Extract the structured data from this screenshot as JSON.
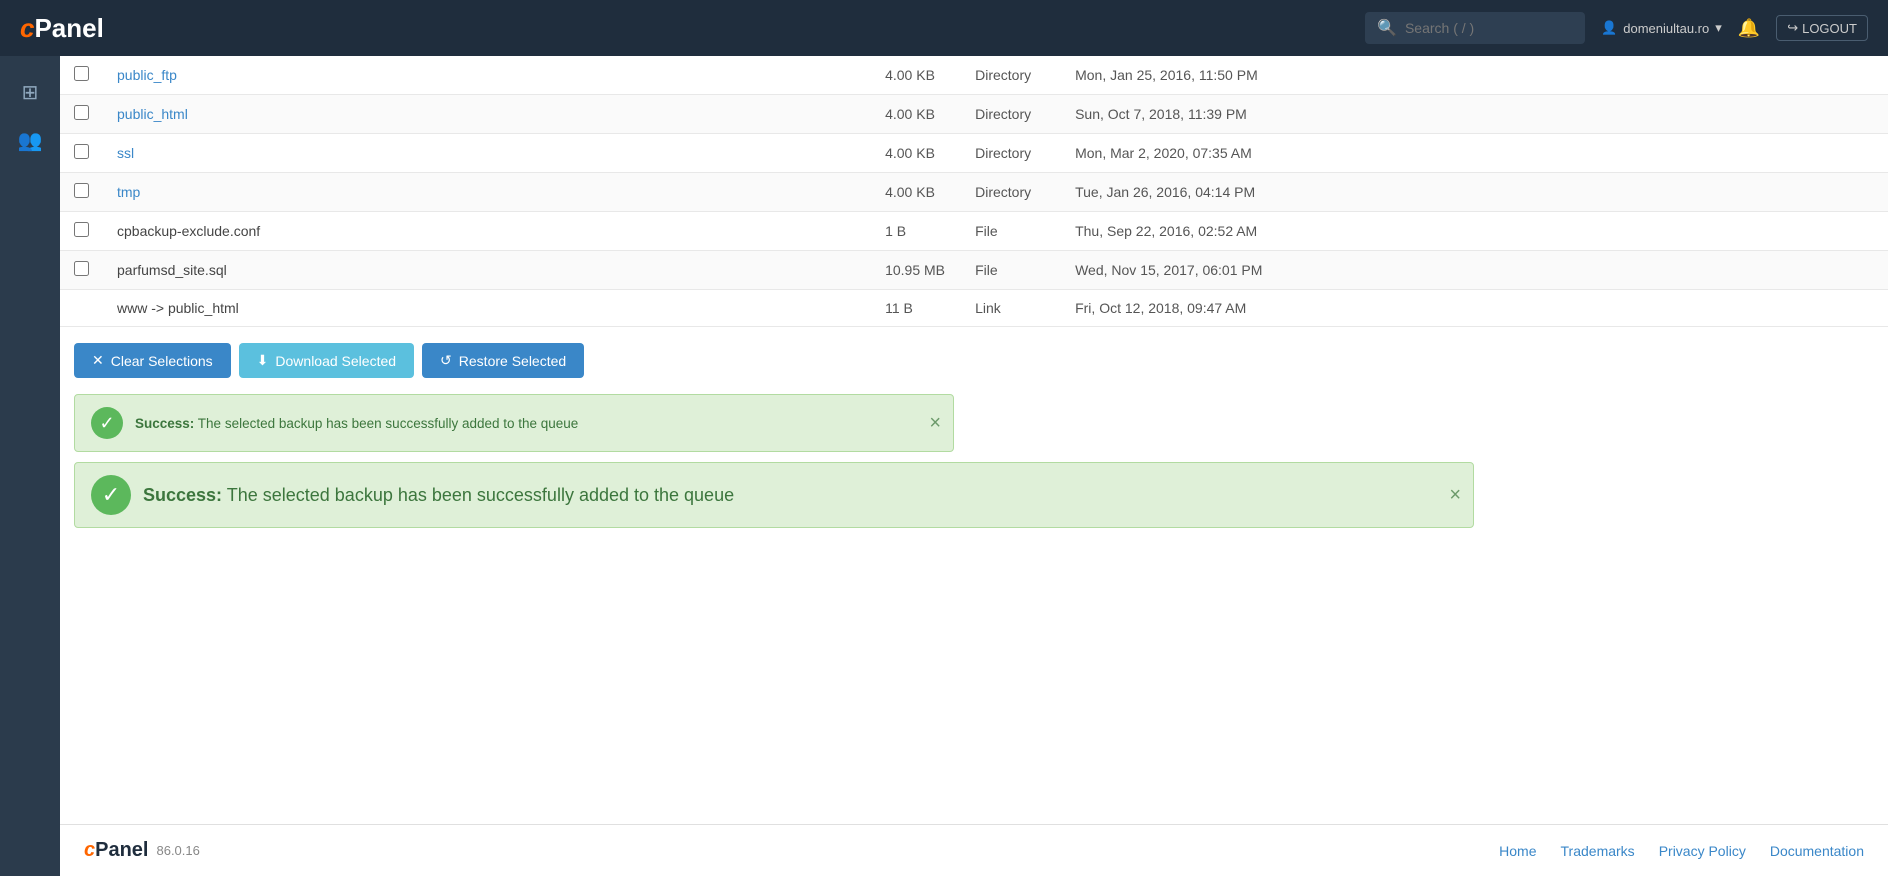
{
  "topnav": {
    "logo": "cPanel",
    "search_placeholder": "Search ( / )",
    "user": "domeniultau.ro",
    "bell_label": "Notifications",
    "logout_label": "LOGOUT"
  },
  "sidebar": {
    "items": [
      {
        "id": "grid",
        "icon": "⊞",
        "label": "Apps"
      },
      {
        "id": "users",
        "icon": "👥",
        "label": "Users"
      }
    ]
  },
  "file_table": {
    "rows": [
      {
        "id": "row-public-ftp",
        "name": "public_ftp",
        "is_link": true,
        "size": "4.00 KB",
        "type": "Directory",
        "date": "Mon, Jan 25, 2016, 11:50 PM",
        "has_checkbox": true
      },
      {
        "id": "row-public-html",
        "name": "public_html",
        "is_link": true,
        "size": "4.00 KB",
        "type": "Directory",
        "date": "Sun, Oct 7, 2018, 11:39 PM",
        "has_checkbox": true
      },
      {
        "id": "row-ssl",
        "name": "ssl",
        "is_link": true,
        "size": "4.00 KB",
        "type": "Directory",
        "date": "Mon, Mar 2, 2020, 07:35 AM",
        "has_checkbox": true
      },
      {
        "id": "row-tmp",
        "name": "tmp",
        "is_link": true,
        "size": "4.00 KB",
        "type": "Directory",
        "date": "Tue, Jan 26, 2016, 04:14 PM",
        "has_checkbox": true
      },
      {
        "id": "row-cpbackup",
        "name": "cpbackup-exclude.conf",
        "is_link": false,
        "size": "1 B",
        "type": "File",
        "date": "Thu, Sep 22, 2016, 02:52 AM",
        "has_checkbox": true
      },
      {
        "id": "row-parfumsd",
        "name": "parfumsd_site.sql",
        "is_link": false,
        "size": "10.95 MB",
        "type": "File",
        "date": "Wed, Nov 15, 2017, 06:01 PM",
        "has_checkbox": true
      },
      {
        "id": "row-www",
        "name": "www -> public_html",
        "is_link": false,
        "size": "11 B",
        "type": "Link",
        "date": "Fri, Oct 12, 2018, 09:47 AM",
        "has_checkbox": false
      }
    ]
  },
  "action_bar": {
    "clear_label": "Clear Selections",
    "download_label": "Download Selected",
    "restore_label": "Restore Selected"
  },
  "alerts": {
    "small": {
      "prefix": "Success:",
      "message": " The selected backup has been successfully added to the queue"
    },
    "large": {
      "prefix": "Success:",
      "message": " The selected backup has been successfully added to the queue"
    }
  },
  "footer": {
    "logo": "cPanel",
    "version": "86.0.16",
    "links": [
      "Home",
      "Trademarks",
      "Privacy Policy",
      "Documentation"
    ]
  }
}
